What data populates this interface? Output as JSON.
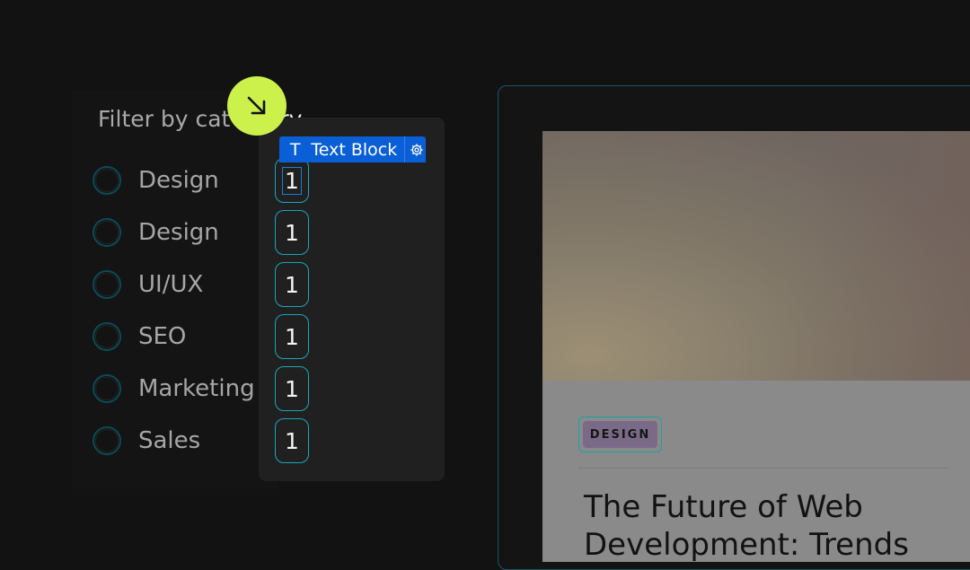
{
  "filter": {
    "title_visible": "Filter by cat",
    "title_tail": "ry",
    "categories": [
      {
        "label": "Design",
        "count": "1"
      },
      {
        "label": "Design",
        "count": "1"
      },
      {
        "label": "UI/UX",
        "count": "1"
      },
      {
        "label": "SEO",
        "count": "1"
      },
      {
        "label": "Marketing",
        "count": "1"
      },
      {
        "label": "Sales",
        "count": "1"
      }
    ]
  },
  "editor": {
    "toolbar_icon": "T",
    "toolbar_label": "Text Block",
    "settings_icon": "gear-icon",
    "cursor_icon": "arrow-down-right-icon"
  },
  "preview": {
    "tag": "DESIGN",
    "title": "The Future of Web Development: Trends"
  },
  "colors": {
    "background": "#121212",
    "accent_cyan": "#19a6bc",
    "toolbar_blue": "#0a5fd6",
    "cursor_lime": "#cbf14a",
    "tag_purple": "#7a6a87"
  }
}
